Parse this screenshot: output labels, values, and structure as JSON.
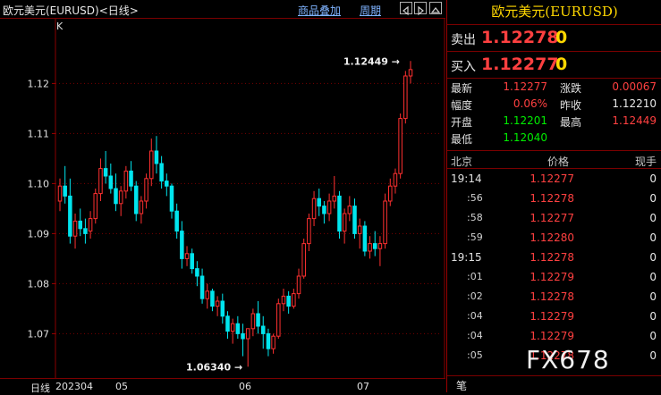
{
  "header": {
    "title": "欧元美元(EURUSD)<日线>",
    "overlay_label": "商品叠加",
    "period_label": "周期"
  },
  "chart_label": "K",
  "chart_data": {
    "type": "candlestick",
    "ylim": [
      1.0615,
      1.1315
    ],
    "yticks": [
      1.07,
      1.08,
      1.09,
      1.1,
      1.11,
      1.12
    ],
    "ytick_labels": [
      "1.07",
      "1.08",
      "1.09",
      "1.10",
      "1.11",
      "1.12"
    ],
    "xtick_labels": [
      "202304",
      "05",
      "06",
      "07"
    ],
    "annotations": [
      {
        "label": "1.12449",
        "value": 1.12449
      },
      {
        "label": "1.06340",
        "value": 1.0634
      }
    ],
    "colors": {
      "up": "#ff3030",
      "down": "#00e5ee"
    },
    "candles": [
      [
        1.0965,
        1.101,
        1.0945,
        1.0995
      ],
      [
        1.0995,
        1.1035,
        1.096,
        1.0975
      ],
      [
        1.0975,
        1.101,
        1.088,
        1.0895
      ],
      [
        1.0895,
        1.094,
        1.087,
        1.0925
      ],
      [
        1.0925,
        1.095,
        1.0895,
        1.091
      ],
      [
        1.091,
        1.093,
        1.088,
        1.09
      ],
      [
        1.0905,
        1.0945,
        1.089,
        1.093
      ],
      [
        1.093,
        1.099,
        1.092,
        1.098
      ],
      [
        1.098,
        1.105,
        1.0965,
        1.103
      ],
      [
        1.103,
        1.1065,
        1.1,
        1.1015
      ],
      [
        1.1015,
        1.104,
        1.098,
        1.099
      ],
      [
        1.099,
        1.102,
        1.0945,
        1.096
      ],
      [
        1.096,
        1.0995,
        1.0935,
        1.0985
      ],
      [
        1.0985,
        1.1035,
        1.097,
        1.1025
      ],
      [
        1.1025,
        1.1045,
        1.0985,
        1.0995
      ],
      [
        1.0995,
        1.1005,
        1.0925,
        1.094
      ],
      [
        1.094,
        1.0975,
        1.092,
        1.0965
      ],
      [
        1.0965,
        1.102,
        1.095,
        1.101
      ],
      [
        1.101,
        1.109,
        1.0995,
        1.1065
      ],
      [
        1.1065,
        1.1095,
        1.102,
        1.104
      ],
      [
        1.104,
        1.1055,
        1.099,
        1.1005
      ],
      [
        1.1005,
        1.102,
        1.0975,
        1.0995
      ],
      [
        1.0995,
        1.1,
        1.093,
        1.0945
      ],
      [
        1.0945,
        1.096,
        1.089,
        1.0905
      ],
      [
        1.0905,
        1.0925,
        1.083,
        1.085
      ],
      [
        1.085,
        1.0875,
        1.0835,
        1.086
      ],
      [
        1.086,
        1.087,
        1.082,
        1.083
      ],
      [
        1.083,
        1.0845,
        1.0795,
        1.0815
      ],
      [
        1.0815,
        1.083,
        1.076,
        1.077
      ],
      [
        1.077,
        1.08,
        1.075,
        1.0785
      ],
      [
        1.0785,
        1.079,
        1.0745,
        1.0755
      ],
      [
        1.0755,
        1.0775,
        1.0735,
        1.0765
      ],
      [
        1.0765,
        1.078,
        1.072,
        1.0735
      ],
      [
        1.0735,
        1.0745,
        1.069,
        1.0705
      ],
      [
        1.0705,
        1.073,
        1.068,
        1.072
      ],
      [
        1.072,
        1.0735,
        1.069,
        1.07
      ],
      [
        1.07,
        1.072,
        1.0655,
        1.069
      ],
      [
        1.069,
        1.07,
        1.0634,
        1.071
      ],
      [
        1.071,
        1.075,
        1.0695,
        1.074
      ],
      [
        1.074,
        1.0765,
        1.07,
        1.0715
      ],
      [
        1.0715,
        1.0735,
        1.067,
        1.07
      ],
      [
        1.07,
        1.071,
        1.0655,
        1.067
      ],
      [
        1.067,
        1.07,
        1.066,
        1.0695
      ],
      [
        1.0695,
        1.077,
        1.069,
        1.076
      ],
      [
        1.076,
        1.079,
        1.0745,
        1.0775
      ],
      [
        1.0775,
        1.0785,
        1.074,
        1.0755
      ],
      [
        1.0755,
        1.079,
        1.075,
        1.078
      ],
      [
        1.078,
        1.083,
        1.077,
        1.0815
      ],
      [
        1.0815,
        1.089,
        1.081,
        1.088
      ],
      [
        1.088,
        1.094,
        1.0865,
        1.093
      ],
      [
        1.093,
        1.0985,
        1.0915,
        1.097
      ],
      [
        1.097,
        1.099,
        1.0935,
        1.0955
      ],
      [
        1.0955,
        1.0965,
        1.092,
        1.094
      ],
      [
        1.094,
        1.098,
        1.0925,
        1.0965
      ],
      [
        1.0965,
        1.1015,
        1.095,
        1.0975
      ],
      [
        1.0975,
        1.0985,
        1.089,
        1.0905
      ],
      [
        1.0905,
        1.095,
        1.088,
        1.094
      ],
      [
        1.094,
        1.0975,
        1.0925,
        1.0955
      ],
      [
        1.0955,
        1.097,
        1.089,
        1.09
      ],
      [
        1.09,
        1.093,
        1.087,
        1.0915
      ],
      [
        1.0915,
        1.0925,
        1.0855,
        1.0865
      ],
      [
        1.0865,
        1.0895,
        1.085,
        1.088
      ],
      [
        1.088,
        1.0905,
        1.0855,
        1.087
      ],
      [
        1.087,
        1.0895,
        1.0835,
        1.088
      ],
      [
        1.088,
        1.098,
        1.087,
        1.0965
      ],
      [
        1.0965,
        1.101,
        1.0955,
        1.0995
      ],
      [
        1.0995,
        1.103,
        1.098,
        1.102
      ],
      [
        1.102,
        1.114,
        1.101,
        1.113
      ],
      [
        1.113,
        1.1225,
        1.112,
        1.1215
      ],
      [
        1.1215,
        1.12449,
        1.12,
        1.12277
      ]
    ]
  },
  "panel": {
    "title": "欧元美元(EURUSD)",
    "sell_label": "卖出",
    "sell_price": "1.12278",
    "sell_vol": "0",
    "buy_label": "买入",
    "buy_price": "1.12277",
    "buy_vol": "0",
    "stats": {
      "latest_label": "最新",
      "latest_val": "1.12277",
      "change_label": "涨跌",
      "change_val": "0.00067",
      "range_label": "幅度",
      "range_val": "0.06%",
      "prev_close_label": "昨收",
      "prev_close_val": "1.12210",
      "open_label": "开盘",
      "open_val": "1.12201",
      "high_label": "最高",
      "high_val": "1.12449",
      "low_label": "最低",
      "low_val": "1.12040"
    },
    "tick_header": {
      "time": "北京",
      "price": "价格",
      "vol": "现手"
    },
    "ticks": [
      {
        "time": "19:14",
        "price": "1.12277",
        "vol": "0"
      },
      {
        "time": ":56",
        "price": "1.12278",
        "vol": "0"
      },
      {
        "time": ":58",
        "price": "1.12277",
        "vol": "0"
      },
      {
        "time": ":59",
        "price": "1.12280",
        "vol": "0"
      },
      {
        "time": "19:15",
        "price": "1.12278",
        "vol": "0"
      },
      {
        "time": ":01",
        "price": "1.12279",
        "vol": "0"
      },
      {
        "time": ":02",
        "price": "1.12278",
        "vol": "0"
      },
      {
        "time": ":04",
        "price": "1.12279",
        "vol": "0"
      },
      {
        "time": ":04",
        "price": "1.12279",
        "vol": "0"
      },
      {
        "time": ":05",
        "price": "1.12278",
        "vol": "0"
      }
    ],
    "tab_label": "笔"
  },
  "footer": {
    "period_label": "日线"
  },
  "watermark": "FX678"
}
